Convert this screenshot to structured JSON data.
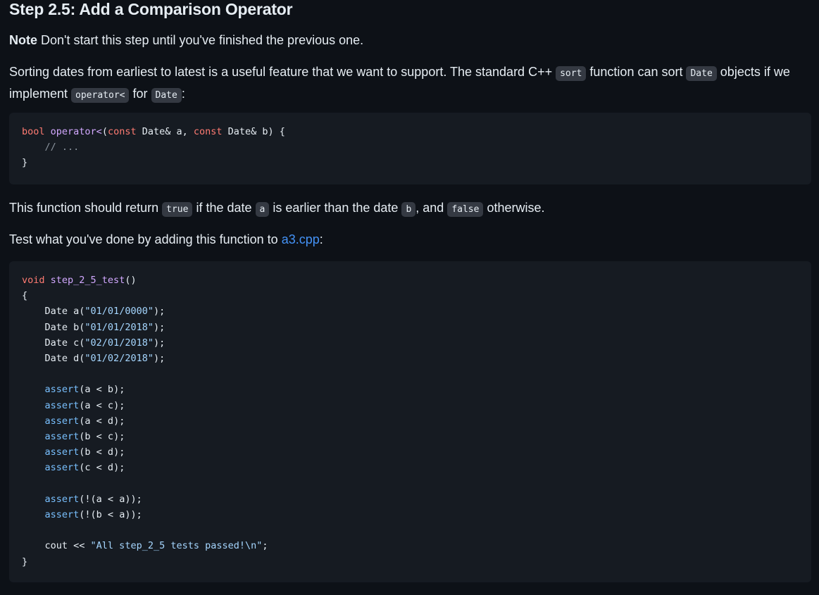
{
  "heading": "Step 2.5: Add a Comparison Operator",
  "note": {
    "label": "Note",
    "text": " Don't start this step until you've finished the previous one."
  },
  "intro": {
    "t1": "Sorting dates from earliest to latest is a useful feature that we want to support. The standard C++ ",
    "c1": "sort",
    "t2": " function can sort ",
    "c2": "Date",
    "t3": " objects if we implement ",
    "c3": "operator<",
    "t4": " for ",
    "c4": "Date",
    "t5": ":"
  },
  "code1": {
    "l1_kw1": "bool",
    "l1_fn": "operator<",
    "l1_p1": "(",
    "l1_kw2": "const",
    "l1_p2": " Date& a, ",
    "l1_kw3": "const",
    "l1_p3": " Date& b) {",
    "l2_cm": "// ...",
    "l3": "}"
  },
  "ret": {
    "t1": "This function should return ",
    "c1": "true",
    "t2": " if the date ",
    "c2": "a",
    "t3": " is earlier than the date ",
    "c3": "b",
    "t4": ", and ",
    "c4": "false",
    "t5": " otherwise."
  },
  "test": {
    "t1": "Test what you've done by adding this function to ",
    "link": "a3.cpp",
    "t2": ":"
  },
  "code2": {
    "kw_void": "void",
    "fn_name": "step_2_5_test",
    "fn_parens": "()",
    "open": "{",
    "decls": [
      {
        "pre": "Date a(",
        "str": "\"01/01/0000\"",
        "post": ");"
      },
      {
        "pre": "Date b(",
        "str": "\"01/01/2018\"",
        "post": ");"
      },
      {
        "pre": "Date c(",
        "str": "\"02/01/2018\"",
        "post": ");"
      },
      {
        "pre": "Date d(",
        "str": "\"01/02/2018\"",
        "post": ");"
      }
    ],
    "assert_kw": "assert",
    "asserts1": [
      "(a < b);",
      "(a < c);",
      "(a < d);",
      "(b < c);",
      "(b < d);",
      "(c < d);"
    ],
    "asserts2": [
      "(!(a < a));",
      "(!(b < a));"
    ],
    "cout_pre": "cout << ",
    "cout_str": "\"All step_2_5 tests passed!\\n\"",
    "cout_post": ";",
    "close": "}"
  }
}
